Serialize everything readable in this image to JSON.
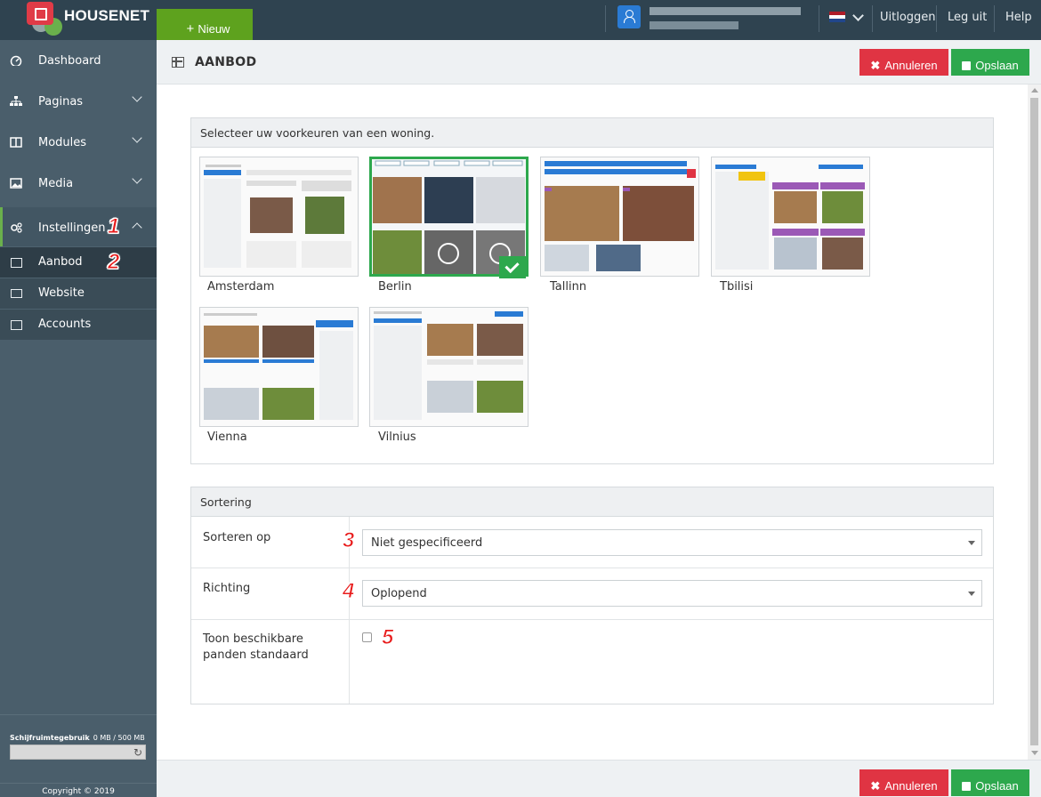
{
  "topbar": {
    "brand": "HOUSENET",
    "new_button": "Nieuw",
    "links": [
      "Uitloggen",
      "Leg uit",
      "Help"
    ],
    "flag_colors": [
      "#ae1c28",
      "#ffffff",
      "#21468b"
    ]
  },
  "sidebar": {
    "items": [
      {
        "label": "Dashboard",
        "icon": "dashboard-icon"
      },
      {
        "label": "Paginas",
        "icon": "sitemap-icon"
      },
      {
        "label": "Modules",
        "icon": "columns-icon"
      },
      {
        "label": "Media",
        "icon": "image-icon"
      },
      {
        "label": "Instellingen",
        "icon": "gears-icon"
      }
    ],
    "subitems": [
      {
        "label": "Aanbod",
        "icon": "table-icon"
      },
      {
        "label": "Website",
        "icon": "monitor-icon"
      },
      {
        "label": "Accounts",
        "icon": "card-icon"
      }
    ],
    "disk_title": "Schijfruimtegebruik",
    "disk_value": "0 MB / 500 MB",
    "copyright": "Copyright © 2019"
  },
  "header": {
    "title": "AANBOD",
    "cancel": "Annuleren",
    "save": "Opslaan"
  },
  "templates_panel": {
    "heading": "Selecteer uw voorkeuren van een woning.",
    "templates": [
      "Amsterdam",
      "Berlin",
      "Tallinn",
      "Tbilisi",
      "Vienna",
      "Vilnius"
    ],
    "selected": "Berlin"
  },
  "sort_panel": {
    "heading": "Sortering",
    "sort_label": "Sorteren op",
    "sort_value": "Niet gespecificeerd",
    "direction_label": "Richting",
    "direction_value": "Oplopend",
    "available_label": "Toon beschikbare panden standaard",
    "available_checked": false
  },
  "markers": [
    "1",
    "2",
    "3",
    "4",
    "5"
  ],
  "colors": {
    "sidebar": "#4a5e6b",
    "topbar": "#2f4350",
    "accent_green": "#2da84d",
    "danger": "#e03443",
    "new_green": "#5ea21e"
  }
}
